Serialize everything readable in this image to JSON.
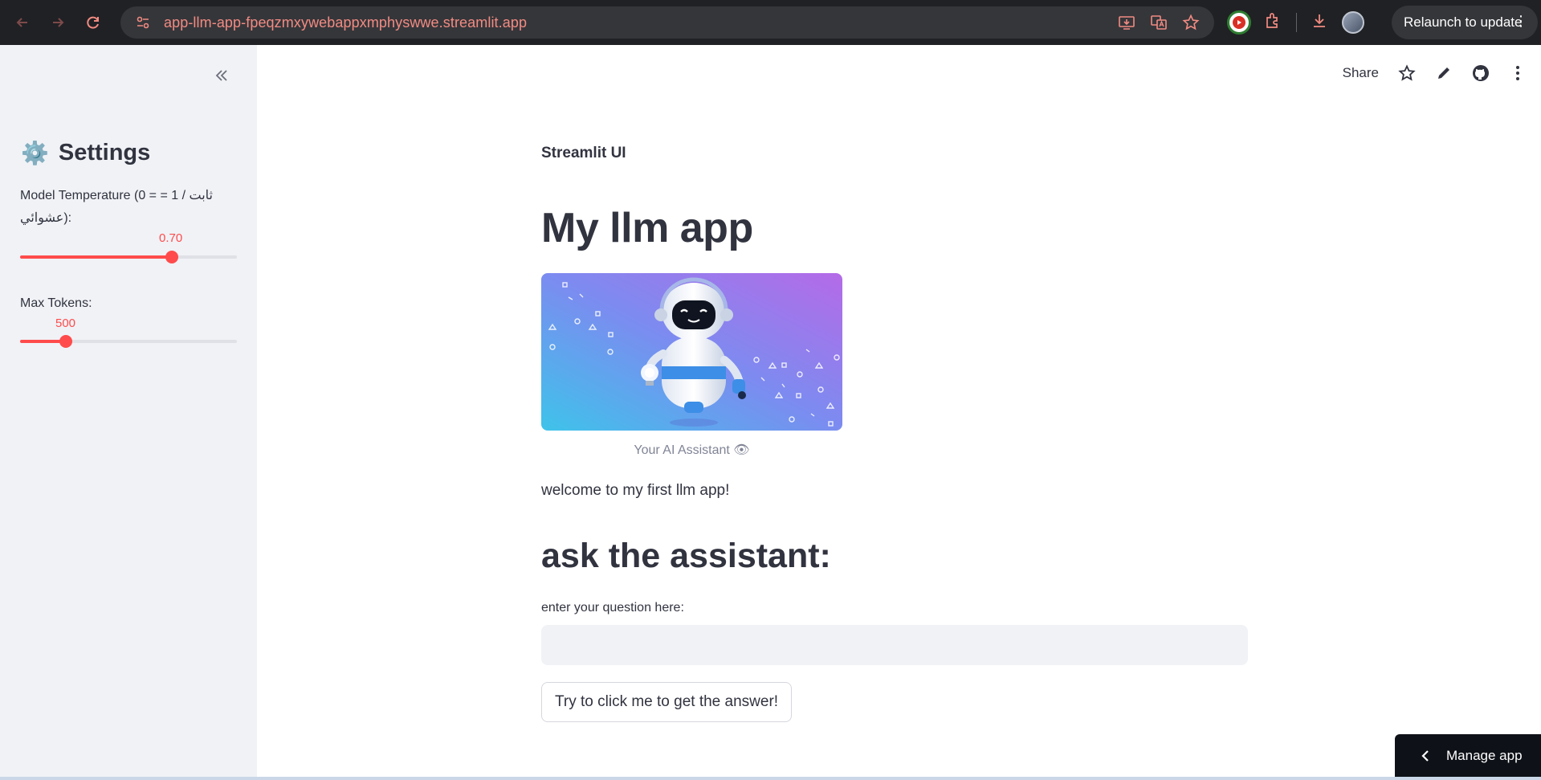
{
  "browser": {
    "url": "app-llm-app-fpeqzmxywebappxmphyswwe.streamlit.app",
    "relaunch_label": "Relaunch to update"
  },
  "sidebar": {
    "collapse_icon": "double-chevron-left-icon",
    "title_icon": "⚙️",
    "title": "Settings",
    "temperature": {
      "label": "Model Temperature (0 = = 1 / ثابت عشوائي):",
      "value_text": "0.70",
      "value": 0.7,
      "min": 0,
      "max": 1
    },
    "max_tokens": {
      "label": "Max Tokens:",
      "value_text": "500",
      "value": 500,
      "fraction": 0.21
    }
  },
  "toolbar": {
    "share_label": "Share",
    "icons": [
      "star-icon",
      "edit-icon",
      "github-icon",
      "more-vert-icon"
    ]
  },
  "main": {
    "brand": "Streamlit UI",
    "title": "My llm app",
    "image_caption": "Your AI Assistant 👁",
    "welcome": "welcome to my first llm app!",
    "subtitle": "ask the assistant:",
    "input_label": "enter your question here:",
    "input_value": "",
    "button_label": "Try to click me to get the answer!"
  },
  "manage_app": {
    "label": "Manage app"
  },
  "colors": {
    "accent": "#ff4b4b",
    "sidebar_bg": "#f0f2f6",
    "text": "#31333f"
  }
}
